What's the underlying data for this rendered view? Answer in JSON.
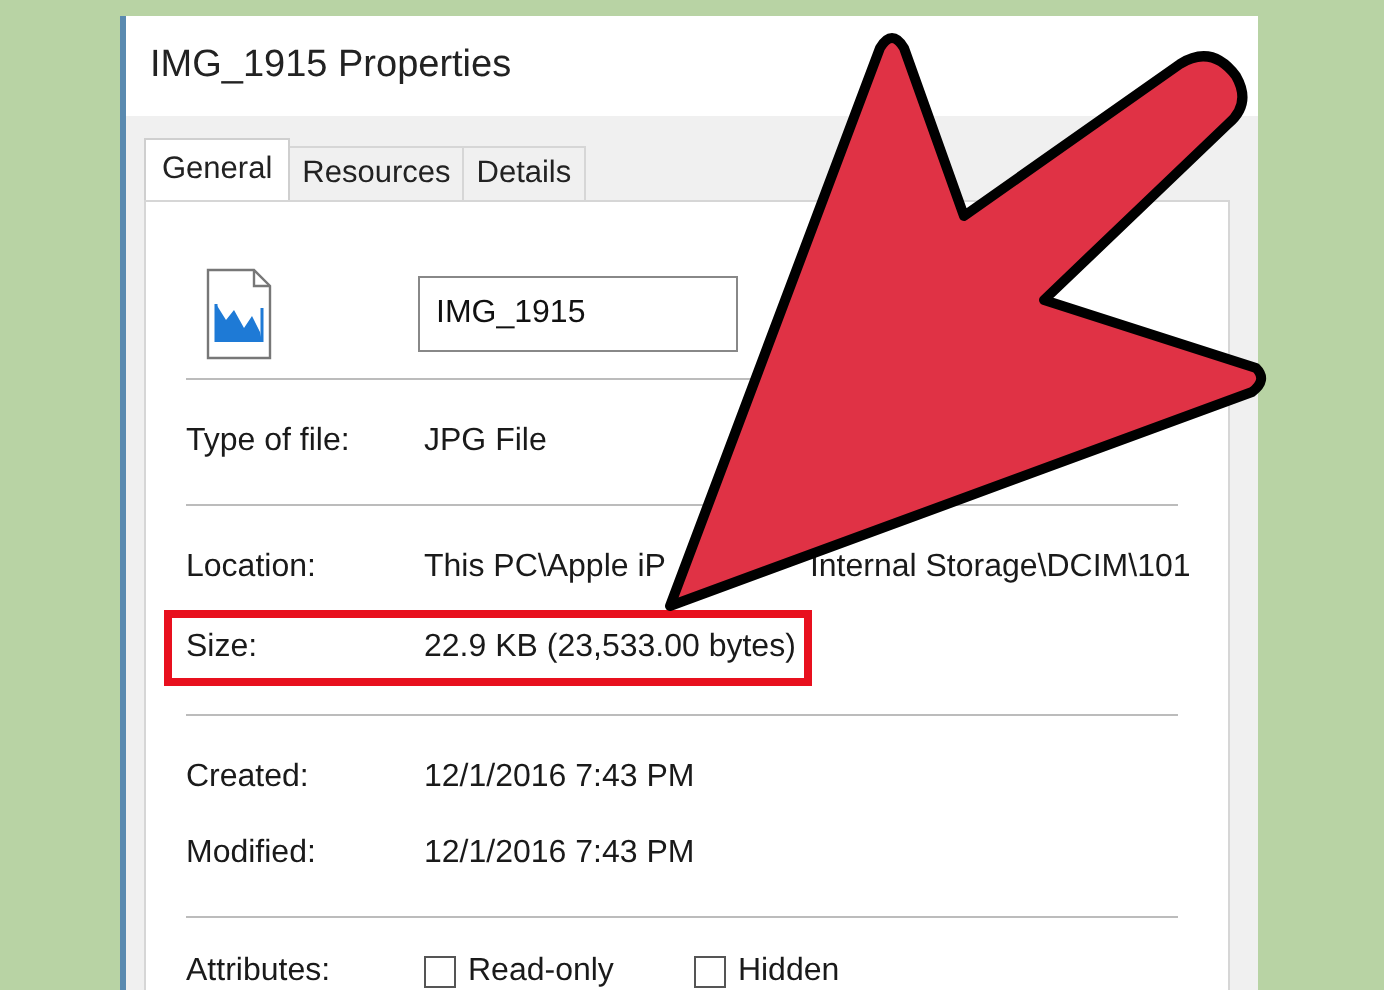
{
  "window": {
    "title": "IMG_1915 Properties"
  },
  "tabs": [
    {
      "label": "General",
      "selected": true
    },
    {
      "label": "Resources",
      "selected": false
    },
    {
      "label": "Details",
      "selected": false
    }
  ],
  "file_name": {
    "value": "IMG_1915"
  },
  "sections": [
    {
      "rows": [
        {
          "label": "Type of file:",
          "value": [
            "JPG File"
          ],
          "highlighted": false
        }
      ]
    },
    {
      "rows": [
        {
          "label": "Location:",
          "value": [
            "This PC\\Apple iP",
            "Internal Storage\\DCIM\\101"
          ],
          "highlighted": false
        },
        {
          "label": "Size:",
          "value": [
            "22.9 KB (23,533.00 bytes)"
          ],
          "highlighted": true
        }
      ]
    },
    {
      "rows": [
        {
          "label": "Created:",
          "value": [
            "12/1/2016 7:43 PM"
          ],
          "highlighted": false
        },
        {
          "label": "Modified:",
          "value": [
            "12/1/2016 7:43 PM"
          ],
          "highlighted": false
        }
      ]
    }
  ],
  "attributes": {
    "label": "Attributes:",
    "options": [
      {
        "label": "Read-only",
        "checked": false
      },
      {
        "label": "Hidden",
        "checked": false
      }
    ]
  },
  "annotation": {
    "kind": "arrow"
  }
}
